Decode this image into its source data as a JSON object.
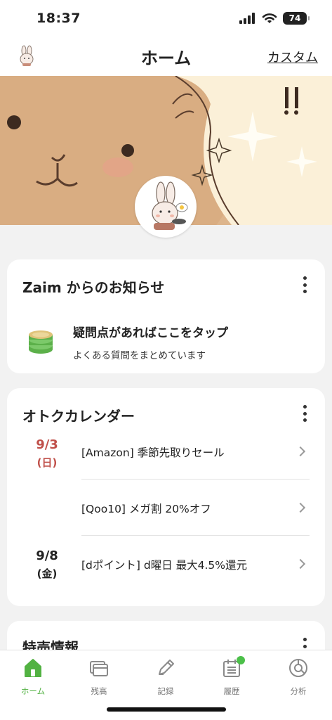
{
  "status_bar": {
    "time": "18:37",
    "battery": "74",
    "icons": [
      "signal-icon",
      "wifi-icon",
      "battery-icon"
    ]
  },
  "nav": {
    "title": "ホーム",
    "custom_label": "カスタム"
  },
  "notice_card": {
    "title": "Zaim からのお知らせ",
    "item_main": "疑問点があればここをタップ",
    "item_sub": "よくある質問をまとめています",
    "icon": "coin-stack-icon"
  },
  "calendar_card": {
    "title": "オトクカレンダー",
    "rows": [
      {
        "date": "9/3",
        "weekday": "(日)",
        "label": "[Amazon] 季節先取りセール",
        "date_color": "#c0504a"
      },
      {
        "date": "",
        "weekday": "",
        "label": "[Qoo10] メガ割 20%オフ",
        "date_color": "#222222"
      },
      {
        "date": "9/8",
        "weekday": "(金)",
        "label": "[dポイント] d曜日 最大4.5%還元",
        "date_color": "#222222"
      }
    ]
  },
  "sale_card": {
    "title": "特売情報"
  },
  "tabs": [
    {
      "label": "ホーム",
      "icon": "home-icon",
      "active": true
    },
    {
      "label": "残高",
      "icon": "wallet-icon",
      "active": false
    },
    {
      "label": "記録",
      "icon": "pencil-icon",
      "active": false
    },
    {
      "label": "履歴",
      "icon": "calendar-list-icon",
      "active": false,
      "badge": true
    },
    {
      "label": "分析",
      "icon": "pie-chart-icon",
      "active": false
    }
  ],
  "colors": {
    "accent_green": "#52b242",
    "date_red": "#c0504a",
    "background": "#f2f2f2"
  }
}
